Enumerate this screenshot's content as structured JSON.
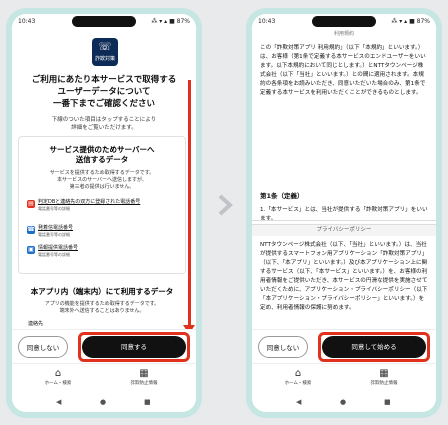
{
  "left_phone": {
    "status": {
      "time": "10:43",
      "right": "⁂ ▾ ▴ ■ 87%"
    },
    "logo": {
      "text": "詐欺対策"
    },
    "headline": [
      "ご利用にあたり本サービスで取得する",
      "ユーザーデータについて",
      "一番下までご確認ください"
    ],
    "subnote": [
      "下線のついた項目はタップすることにより",
      "詳細をご覧いただけます。"
    ],
    "card": {
      "title": [
        "サービス提供のためサーバーへ",
        "送信するデータ"
      ],
      "desc": [
        "サービスを提供するため取得するデータです。",
        "本サービスのサーバーへ送信しますが、",
        "第三者の提供は行いません。"
      ],
      "items": [
        {
          "label": "判定DBと連絡先の双方に登録された電話番号",
          "sub": "電話番号等の詳細",
          "icon": "database-icon",
          "color": "#e0301e",
          "glyph": "▤"
        },
        {
          "label": "発着信電話番号",
          "sub": "電話番号等の詳細",
          "icon": "phone-icon",
          "color": "#1b6fc9",
          "glyph": "☎"
        },
        {
          "label": "情報提供電話番号",
          "sub": "電話番号等の詳細",
          "icon": "report-icon",
          "color": "#1b6fc9",
          "glyph": "▣"
        }
      ]
    },
    "section2": {
      "title": "本アプリ内（端末内）にて利用するデータ",
      "desc": [
        "アプリの機能を提供するため取得するデータです。",
        "端末外へ送信することはありません。"
      ],
      "peek": "連絡先"
    },
    "buttons": {
      "decline": "同意しない",
      "agree": "同意する"
    },
    "tabs": [
      {
        "label": "ホーム・検索",
        "icon": "home-icon",
        "glyph": "⌂"
      },
      {
        "label": "詐欺防止情報",
        "icon": "news-icon",
        "glyph": "▦"
      }
    ],
    "nav": {
      "back": "◀",
      "home": "●",
      "recent": "■"
    }
  },
  "right_phone": {
    "status": {
      "time": "10:43",
      "right": "⁂ ▾ ▴ ■ 87%"
    },
    "doc_header": "利用規約",
    "paragraphs": [
      "この「詐欺対策アプリ 利用規約」（以下「本規約」といいます。）は、お客様（第1条で定義する本サービスのエンドユーザーをいいます。以下本規約において同じとします。）とNTTタウンページ株式会社（以下「当社」といいます。）との間に適用されます。本規約の各条項をお読みいただき、同意いただいた場合のみ、第1条で定義する本サービスを利用いただくことができるものとします。"
    ],
    "article_heading": "第1条（定義）",
    "article_text": "1.「本サービス」とは、当社が提供する「詐欺対策アプリ」をいいます。",
    "privacy": {
      "title": "プライバシーポリシー",
      "text": "NTTタウンページ株式会社（以下、「当社」といいます。）は、当社が提供するスマートフォン用アプリケーション「詐欺対策アプリ」（以下、「本アプリ」といいます。）及び本アプリケーション上に関するサービス（以下、「本サービス」といいます。）を、お客様の利用者情報をご提供いただき、本サービスの円滑な提供を実施させていただくために、アプリケーション・プライバシーポリシー（以下「本アプリケーション・プライバシーポリシー」といいます。）を定め、利用者情報の保護に努めます。"
    },
    "buttons": {
      "decline": "同意しない",
      "agree": "同意して始める"
    },
    "tabs": [
      {
        "label": "ホーム・検索",
        "icon": "home-icon",
        "glyph": "⌂"
      },
      {
        "label": "詐欺防止情報",
        "icon": "news-icon",
        "glyph": "▦"
      }
    ],
    "nav": {
      "back": "◀",
      "home": "●",
      "recent": "■"
    }
  },
  "colors": {
    "accent_red": "#e0301e",
    "phone_frame": "#c6e6e3",
    "logo_navy": "#0d2b56"
  }
}
